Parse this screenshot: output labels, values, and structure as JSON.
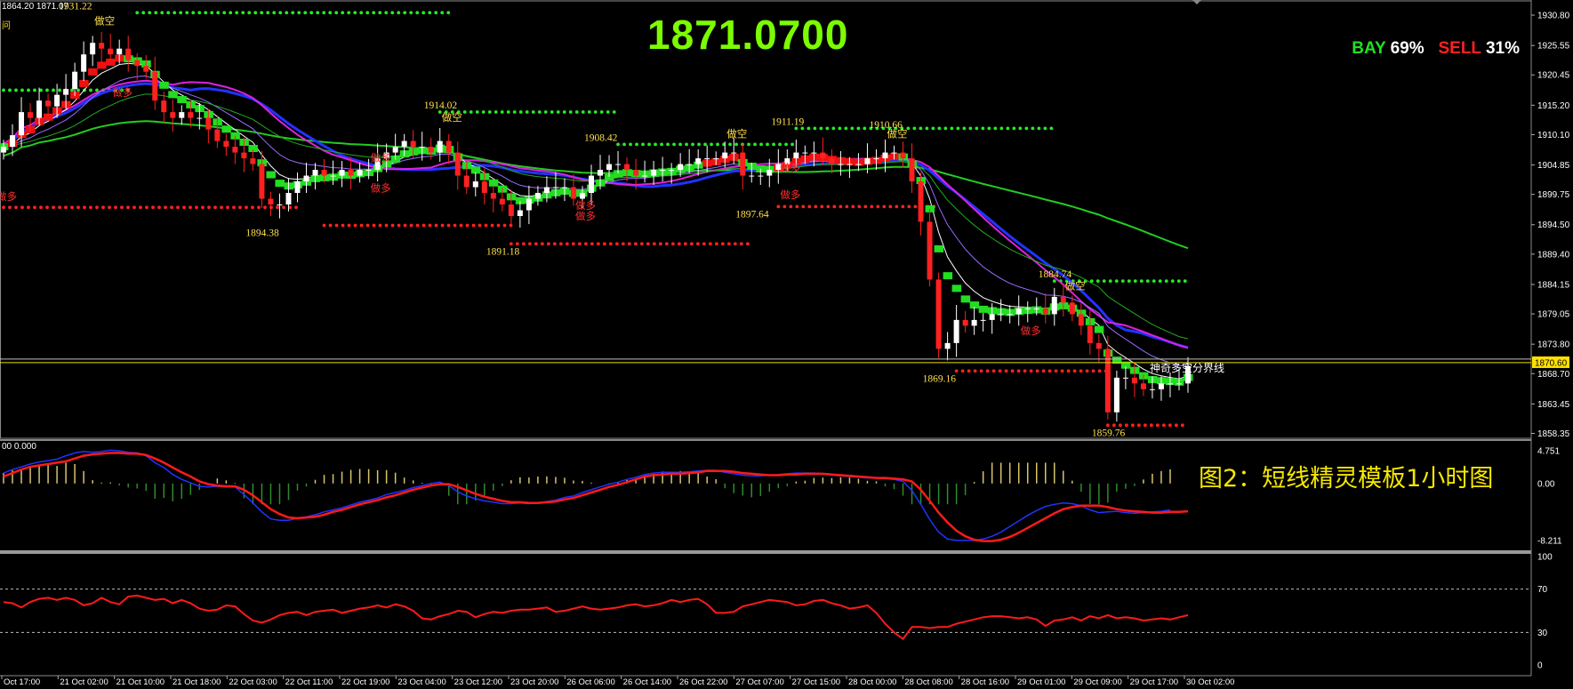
{
  "header": {
    "ohlc_fragment": "1864.20 1871.07",
    "corner_glyph": "问",
    "big_price": "1871.0700",
    "bay_label": "BAY",
    "bay_pct": "69%",
    "sell_label": "SELL",
    "sell_pct": "31%",
    "caption": "图2：短线精灵模板1小时图",
    "macd_label": "00 0.000"
  },
  "colors": {
    "background": "#000000",
    "bull_candle": "#ffffff",
    "bear_candle": "#ff2020",
    "ladder_green": "#22dd22",
    "ladder_red": "#ee1111",
    "ma_green": "#22cc22",
    "ma_blue": "#2233ff",
    "ma_magenta": "#dd22dd",
    "dot_green": "#22ee22",
    "dot_red": "#ff2222",
    "label_yellow": "#ffe14d",
    "price_line": "#e8e000"
  },
  "chart_data": {
    "type": "candlestick",
    "y_ticks": [
      "1930.80",
      "1925.55",
      "1920.45",
      "1915.20",
      "1910.10",
      "1904.85",
      "1899.75",
      "1894.50",
      "1889.40",
      "1884.15",
      "1879.05",
      "1873.80",
      "1868.70",
      "1863.45",
      "1858.35"
    ],
    "ylim": [
      1857.5,
      1932.5
    ],
    "current_price": 1870.6,
    "current_price_label": "1870.60",
    "boundary_line_label": "神奇多空分界线",
    "x_ticks": [
      "Oct 17:00",
      "21 Oct 02:00",
      "21 Oct 10:00",
      "21 Oct 18:00",
      "22 Oct 03:00",
      "22 Oct 11:00",
      "22 Oct 19:00",
      "23 Oct 04:00",
      "23 Oct 12:00",
      "23 Oct 20:00",
      "26 Oct 06:00",
      "26 Oct 14:00",
      "26 Oct 22:00",
      "27 Oct 07:00",
      "27 Oct 15:00",
      "28 Oct 00:00",
      "28 Oct 08:00",
      "28 Oct 16:00",
      "29 Oct 01:00",
      "29 Oct 09:00",
      "29 Oct 17:00",
      "30 Oct 02:00"
    ],
    "swing_labels": [
      {
        "i": 8,
        "price": 1931.22,
        "text": "1931.22",
        "pos": "above"
      },
      {
        "i": 29,
        "price": 1894.38,
        "text": "1894.38",
        "pos": "below"
      },
      {
        "i": 49,
        "price": 1914.02,
        "text": "1914.02",
        "pos": "above"
      },
      {
        "i": 56,
        "price": 1891.18,
        "text": "1891.18",
        "pos": "below"
      },
      {
        "i": 67,
        "price": 1908.42,
        "text": "1908.42",
        "pos": "above"
      },
      {
        "i": 84,
        "price": 1897.64,
        "text": "1897.64",
        "pos": "below"
      },
      {
        "i": 88,
        "price": 1911.19,
        "text": "1911.19",
        "pos": "above"
      },
      {
        "i": 99,
        "price": 1910.66,
        "text": "1910.66",
        "pos": "above"
      },
      {
        "i": 105,
        "price": 1869.16,
        "text": "1869.16",
        "pos": "below"
      },
      {
        "i": 118,
        "price": 1884.74,
        "text": "1884.74",
        "pos": "above"
      },
      {
        "i": 124,
        "price": 1859.76,
        "text": "1859.76",
        "pos": "below"
      }
    ],
    "signal_labels": [
      {
        "i": 11,
        "price": 1929.2,
        "text": "做空",
        "color": "#ffe14d"
      },
      {
        "i": 13,
        "price": 1916.8,
        "text": "做多",
        "color": "#ff3030"
      },
      {
        "i": 0,
        "price": 1898.8,
        "text": "做多",
        "color": "#ff3030"
      },
      {
        "i": 42,
        "price": 1900.2,
        "text": "做多",
        "color": "#ff3030"
      },
      {
        "i": 42,
        "price": 1905.5,
        "text": "做多",
        "color": "#ff3030"
      },
      {
        "i": 50,
        "price": 1912.5,
        "text": "做空",
        "color": "#ffe14d"
      },
      {
        "i": 65,
        "price": 1897.2,
        "text": "做多",
        "color": "#ff3030"
      },
      {
        "i": 65,
        "price": 1895.4,
        "text": "做多",
        "color": "#ff3030"
      },
      {
        "i": 82,
        "price": 1909.6,
        "text": "做空",
        "color": "#ffe14d"
      },
      {
        "i": 88,
        "price": 1899.1,
        "text": "做多",
        "color": "#ff3030"
      },
      {
        "i": 88,
        "price": 1903.8,
        "text": "做多",
        "color": "#ff3030"
      },
      {
        "i": 100,
        "price": 1909.6,
        "text": "做空",
        "color": "#ffe14d"
      },
      {
        "i": 115,
        "price": 1875.5,
        "text": "做多",
        "color": "#ff3030"
      },
      {
        "i": 120,
        "price": 1883.3,
        "text": "做空",
        "color": "#ffe14d"
      }
    ],
    "level_dots": [
      {
        "from": 15,
        "to": 50,
        "price": 1931.22,
        "color": "green"
      },
      {
        "from": 0,
        "to": 14,
        "price": 1917.8,
        "color": "green"
      },
      {
        "from": 49,
        "to": 69,
        "price": 1914.02,
        "color": "green"
      },
      {
        "from": 69,
        "to": 89,
        "price": 1908.42,
        "color": "green"
      },
      {
        "from": 89,
        "to": 118,
        "price": 1911.19,
        "color": "green"
      },
      {
        "from": 118,
        "to": 133,
        "price": 1884.74,
        "color": "green"
      },
      {
        "from": 0,
        "to": 33,
        "price": 1897.5,
        "color": "red"
      },
      {
        "from": 36,
        "to": 57,
        "price": 1894.38,
        "color": "red"
      },
      {
        "from": 57,
        "to": 84,
        "price": 1891.18,
        "color": "red"
      },
      {
        "from": 87,
        "to": 105,
        "price": 1897.64,
        "color": "red"
      },
      {
        "from": 107,
        "to": 124,
        "price": 1869.16,
        "color": "red"
      },
      {
        "from": 124,
        "to": 133,
        "price": 1859.76,
        "color": "red"
      }
    ],
    "closes": [
      1908,
      1910,
      1914,
      1913,
      1916,
      1915,
      1917,
      1918,
      1921,
      1924,
      1926,
      1925,
      1924,
      1925,
      1923,
      1922,
      1921,
      1916,
      1914,
      1913,
      1914,
      1913,
      1913,
      1911,
      1909,
      1908,
      1907,
      1906,
      1905,
      1899,
      1898,
      1898,
      1900,
      1902,
      1903,
      1904,
      1903,
      1903,
      1904,
      1903,
      1904,
      1904,
      1906,
      1907,
      1908,
      1909,
      1908,
      1908,
      1907,
      1909,
      1907,
      1903,
      1901,
      1902,
      1900,
      1899,
      1898,
      1896,
      1897,
      1899,
      1900,
      1901,
      1901,
      1901,
      1899,
      1900,
      1903,
      1904,
      1905,
      1905,
      1904,
      1903,
      1903,
      1904,
      1904,
      1904,
      1905,
      1905,
      1906,
      1906,
      1906,
      1907,
      1907,
      1903,
      1903,
      1903,
      1904,
      1905,
      1906,
      1907,
      1907,
      1907,
      1906,
      1905,
      1905,
      1905,
      1905,
      1906,
      1906,
      1907,
      1907,
      1906,
      1902,
      1895,
      1885,
      1873,
      1874,
      1878,
      1877,
      1878,
      1878,
      1879,
      1879,
      1879,
      1880,
      1880,
      1880,
      1879,
      1882,
      1881,
      1879,
      1877,
      1874,
      1873,
      1862,
      1868,
      1868,
      1867,
      1866,
      1866,
      1867,
      1867,
      1867,
      1870
    ],
    "series_ma": [
      {
        "name": "",
        "color": "#22cc22",
        "from": 1902,
        "to": 1902,
        "control": [
          1902,
          1906,
          1908,
          1908,
          1907,
          1906,
          1905,
          1904,
          1902,
          1901
        ]
      },
      {
        "name": "",
        "color": "#2233ff",
        "control": [
          1902,
          1910,
          1912,
          1912,
          1908,
          1905,
          1904,
          1902,
          1897,
          1886
        ]
      },
      {
        "name": "",
        "color": "#dd22dd",
        "control": [
          1901,
          1909,
          1912,
          1912,
          1908,
          1905,
          1904,
          1903,
          1898,
          1887
        ]
      }
    ],
    "macd": {
      "ylim": [
        -9.5,
        6.0
      ],
      "y_ticks": [
        "4.751",
        "0.00",
        "-8.211"
      ],
      "signal_red": [
        1.0,
        1.5,
        2.0,
        2.4,
        2.6,
        2.8,
        3.0,
        3.2,
        3.6,
        4.0,
        4.2,
        4.3,
        4.4,
        4.4,
        4.3,
        4.3,
        4.1,
        3.6,
        3.0,
        2.3,
        1.6,
        1.0,
        0.3,
        -0.1,
        -0.3,
        -0.4,
        -0.4,
        -0.9,
        -1.7,
        -2.7,
        -3.7,
        -4.4,
        -4.9,
        -5.0,
        -4.9,
        -4.8,
        -4.5,
        -4.1,
        -3.8,
        -3.4,
        -3.0,
        -2.7,
        -2.4,
        -2.0,
        -1.7,
        -1.3,
        -0.9,
        -0.6,
        -0.3,
        -0.1,
        -0.1,
        -0.5,
        -1.0,
        -1.5,
        -1.9,
        -2.2,
        -2.5,
        -2.7,
        -2.7,
        -2.8,
        -2.8,
        -2.7,
        -2.6,
        -2.3,
        -2.1,
        -1.7,
        -1.3,
        -0.9,
        -0.5,
        -0.2,
        0.2,
        0.6,
        1.0,
        1.2,
        1.3,
        1.4,
        1.4,
        1.5,
        1.6,
        1.8,
        1.8,
        1.8,
        1.7,
        1.5,
        1.4,
        1.3,
        1.2,
        1.2,
        1.3,
        1.3,
        1.4,
        1.4,
        1.4,
        1.3,
        1.2,
        1.1,
        1.0,
        0.9,
        0.8,
        0.8,
        0.7,
        0.6,
        0.3,
        -0.9,
        -2.5,
        -4.2,
        -5.6,
        -6.8,
        -7.6,
        -8.1,
        -8.3,
        -8.3,
        -8.1,
        -7.7,
        -7.1,
        -6.4,
        -5.7,
        -5.0,
        -4.3,
        -3.7,
        -3.4,
        -3.2,
        -3.2,
        -3.2,
        -3.4,
        -3.7,
        -3.9,
        -4.0,
        -4.1,
        -4.2,
        -4.2,
        -4.1,
        -4.1,
        -4.0
      ],
      "main_blue": [
        1.5,
        2.0,
        2.4,
        2.8,
        3.1,
        3.3,
        3.5,
        4.0,
        4.4,
        4.6,
        4.5,
        4.6,
        4.8,
        4.7,
        4.5,
        4.4,
        4.0,
        3.0,
        2.3,
        1.3,
        0.6,
        0.1,
        -0.4,
        -0.5,
        -0.4,
        -0.5,
        -0.5,
        -1.6,
        -2.8,
        -4.1,
        -5.1,
        -5.3,
        -5.3,
        -5.0,
        -4.8,
        -4.5,
        -4.1,
        -3.8,
        -3.5,
        -3.1,
        -2.7,
        -2.4,
        -2.1,
        -1.6,
        -1.3,
        -1.0,
        -0.6,
        -0.3,
        0.0,
        0.2,
        -0.3,
        -1.2,
        -1.8,
        -2.2,
        -2.5,
        -2.7,
        -2.9,
        -2.9,
        -2.8,
        -2.9,
        -2.8,
        -2.6,
        -2.4,
        -2.0,
        -1.8,
        -1.3,
        -0.9,
        -0.5,
        -0.1,
        0.2,
        0.6,
        0.9,
        1.3,
        1.5,
        1.6,
        1.6,
        1.6,
        1.7,
        1.8,
        1.9,
        1.9,
        1.6,
        1.4,
        1.2,
        1.1,
        1.1,
        1.2,
        1.3,
        1.4,
        1.5,
        1.5,
        1.5,
        1.4,
        1.2,
        1.1,
        1.0,
        0.9,
        0.8,
        0.8,
        0.7,
        0.6,
        0.3,
        -1.0,
        -3.0,
        -5.2,
        -7.0,
        -8.0,
        -8.2,
        -8.2,
        -8.2,
        -8.0,
        -7.6,
        -7.0,
        -6.2,
        -5.4,
        -4.6,
        -3.9,
        -3.3,
        -3.0,
        -2.8,
        -2.9,
        -3.2,
        -3.8,
        -4.2,
        -4.1,
        -4.0,
        -4.2,
        -4.3,
        -4.2,
        -4.1,
        -4.0,
        -3.8
      ]
    },
    "oscillator": {
      "ylim": [
        0,
        100
      ],
      "y_ticks": [
        "100",
        "70",
        "30",
        "0"
      ],
      "levels": [
        70,
        30
      ],
      "values": [
        58,
        57,
        53,
        58,
        61,
        62,
        60,
        62,
        60,
        55,
        57,
        62,
        58,
        56,
        63,
        64,
        62,
        60,
        61,
        57,
        60,
        57,
        52,
        50,
        51,
        55,
        54,
        47,
        41,
        39,
        42,
        46,
        48,
        49,
        46,
        49,
        50,
        51,
        48,
        50,
        52,
        53,
        55,
        53,
        56,
        54,
        50,
        43,
        42,
        45,
        47,
        50,
        49,
        44,
        47,
        49,
        48,
        50,
        51,
        51,
        52,
        53,
        49,
        50,
        52,
        54,
        52,
        51,
        52,
        53,
        55,
        56,
        54,
        55,
        57,
        60,
        58,
        60,
        61,
        56,
        48,
        48,
        49,
        54,
        56,
        58,
        60,
        59,
        58,
        55,
        56,
        59,
        60,
        57,
        55,
        52,
        53,
        55,
        48,
        38,
        30,
        24,
        35,
        35,
        34,
        35,
        35,
        38,
        40,
        42,
        44,
        45,
        45,
        44,
        43,
        44,
        42,
        36,
        41,
        42,
        44,
        41,
        45,
        43,
        46,
        43,
        44,
        43,
        41,
        42,
        43,
        42,
        44,
        46
      ]
    },
    "grid": false,
    "legend": "none"
  }
}
